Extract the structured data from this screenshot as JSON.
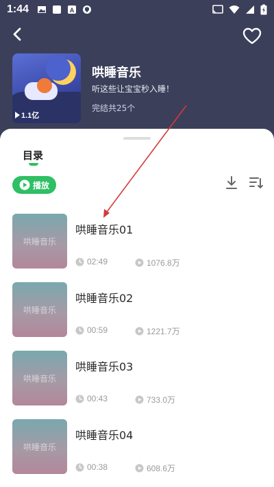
{
  "status_bar": {
    "time": "1:44"
  },
  "album": {
    "title": "哄睡音乐",
    "description": "听这些让宝宝秒入睡！",
    "total": "完结共25个",
    "play_count": "1.1亿"
  },
  "toc": {
    "tab_label": "目录",
    "play_label": "播放"
  },
  "tracks": [
    {
      "title": "哄睡音乐01",
      "thumb_text": "哄睡音乐",
      "duration": "02:49",
      "plays": "1076.8万"
    },
    {
      "title": "哄睡音乐02",
      "thumb_text": "哄睡音乐",
      "duration": "00:59",
      "plays": "1221.7万"
    },
    {
      "title": "哄睡音乐03",
      "thumb_text": "哄睡音乐",
      "duration": "00:43",
      "plays": "733.0万"
    },
    {
      "title": "哄睡音乐04",
      "thumb_text": "哄睡音乐",
      "duration": "00:38",
      "plays": "608.6万"
    }
  ],
  "colors": {
    "header_bg": "#3c3f5a",
    "accent": "#2fbf64",
    "annotation": "#d43a3a"
  },
  "icons": [
    "back-arrow-icon",
    "heart-icon",
    "play-icon",
    "download-icon",
    "sort-icon",
    "clock-icon",
    "play-count-icon"
  ]
}
